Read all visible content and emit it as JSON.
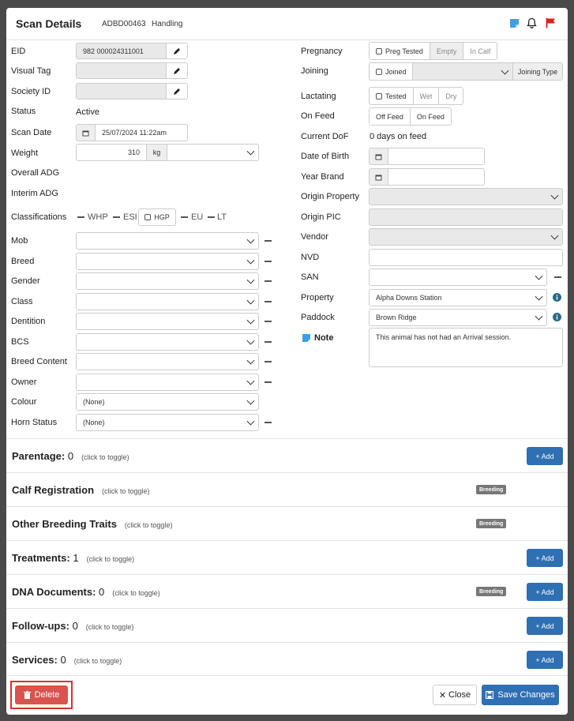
{
  "header": {
    "title": "Scan Details",
    "id": "ADBD00463",
    "subtitle": "Handling"
  },
  "left": {
    "eid_label": "EID",
    "eid_value": "982 000024311001",
    "visual_tag_label": "Visual Tag",
    "society_id_label": "Society ID",
    "status_label": "Status",
    "status_value": "Active",
    "scan_date_label": "Scan Date",
    "scan_date_value": "25/07/2024 11:22am",
    "weight_label": "Weight",
    "weight_value": "310",
    "weight_unit": "kg",
    "overall_adg_label": "Overall ADG",
    "interim_adg_label": "Interim ADG",
    "classifications_label": "Classifications",
    "class_whp": "WHP",
    "class_esi": "ESI",
    "class_hgp": "HGP",
    "class_eu": "EU",
    "class_lt": "LT",
    "mob_label": "Mob",
    "breed_label": "Breed",
    "gender_label": "Gender",
    "class_label": "Class",
    "dentition_label": "Dentition",
    "bcs_label": "BCS",
    "breed_content_label": "Breed Content",
    "owner_label": "Owner",
    "colour_label": "Colour",
    "colour_value": "(None)",
    "horn_status_label": "Horn Status",
    "horn_status_value": "(None)"
  },
  "right": {
    "pregnancy_label": "Pregnancy",
    "preg_tested": "Preg Tested",
    "preg_empty": "Empty",
    "preg_in_calf": "In Calf",
    "joining_label": "Joining",
    "joined": "Joined",
    "joining_type": "Joining Type",
    "lactating_label": "Lactating",
    "lact_tested": "Tested",
    "lact_wet": "Wet",
    "lact_dry": "Dry",
    "on_feed_label": "On Feed",
    "off_feed": "Off Feed",
    "on_feed": "On Feed",
    "current_dof_label": "Current DoF",
    "current_dof_value": "0 days on feed",
    "dob_label": "Date of Birth",
    "year_brand_label": "Year Brand",
    "origin_property_label": "Origin Property",
    "origin_pic_label": "Origin PIC",
    "vendor_label": "Vendor",
    "nvd_label": "NVD",
    "san_label": "SAN",
    "property_label": "Property",
    "property_value": "Alpha Downs Station",
    "paddock_label": "Paddock",
    "paddock_value": "Brown Ridge",
    "note_label": "Note",
    "note_value": "This animal has not had an Arrival session."
  },
  "sections": [
    {
      "title": "Parentage:",
      "count": "0",
      "toggle": "(click to toggle)",
      "add": "+ Add"
    },
    {
      "title": "Calf Registration",
      "toggle": "(click to toggle)",
      "badge": "Breeding"
    },
    {
      "title": "Other Breeding Traits",
      "toggle": "(click to toggle)",
      "badge": "Breeding"
    },
    {
      "title": "Treatments:",
      "count": "1",
      "toggle": "(click to toggle)",
      "add": "+ Add"
    },
    {
      "title": "DNA Documents:",
      "count": "0",
      "toggle": "(click to toggle)",
      "badge": "Breeding",
      "add": "+ Add"
    },
    {
      "title": "Follow-ups:",
      "count": "0",
      "toggle": "(click to toggle)",
      "add": "+ Add"
    },
    {
      "title": "Services:",
      "count": "0",
      "toggle": "(click to toggle)",
      "add": "+ Add"
    }
  ],
  "footer": {
    "delete": "Delete",
    "close": "Close",
    "save": "Save Changes"
  },
  "colors": {
    "primary": "#2f6fb3",
    "danger": "#d9534f",
    "flag": "#e02020",
    "note_icon": "#3aa0e8",
    "info_icon": "#2a6a8a"
  }
}
